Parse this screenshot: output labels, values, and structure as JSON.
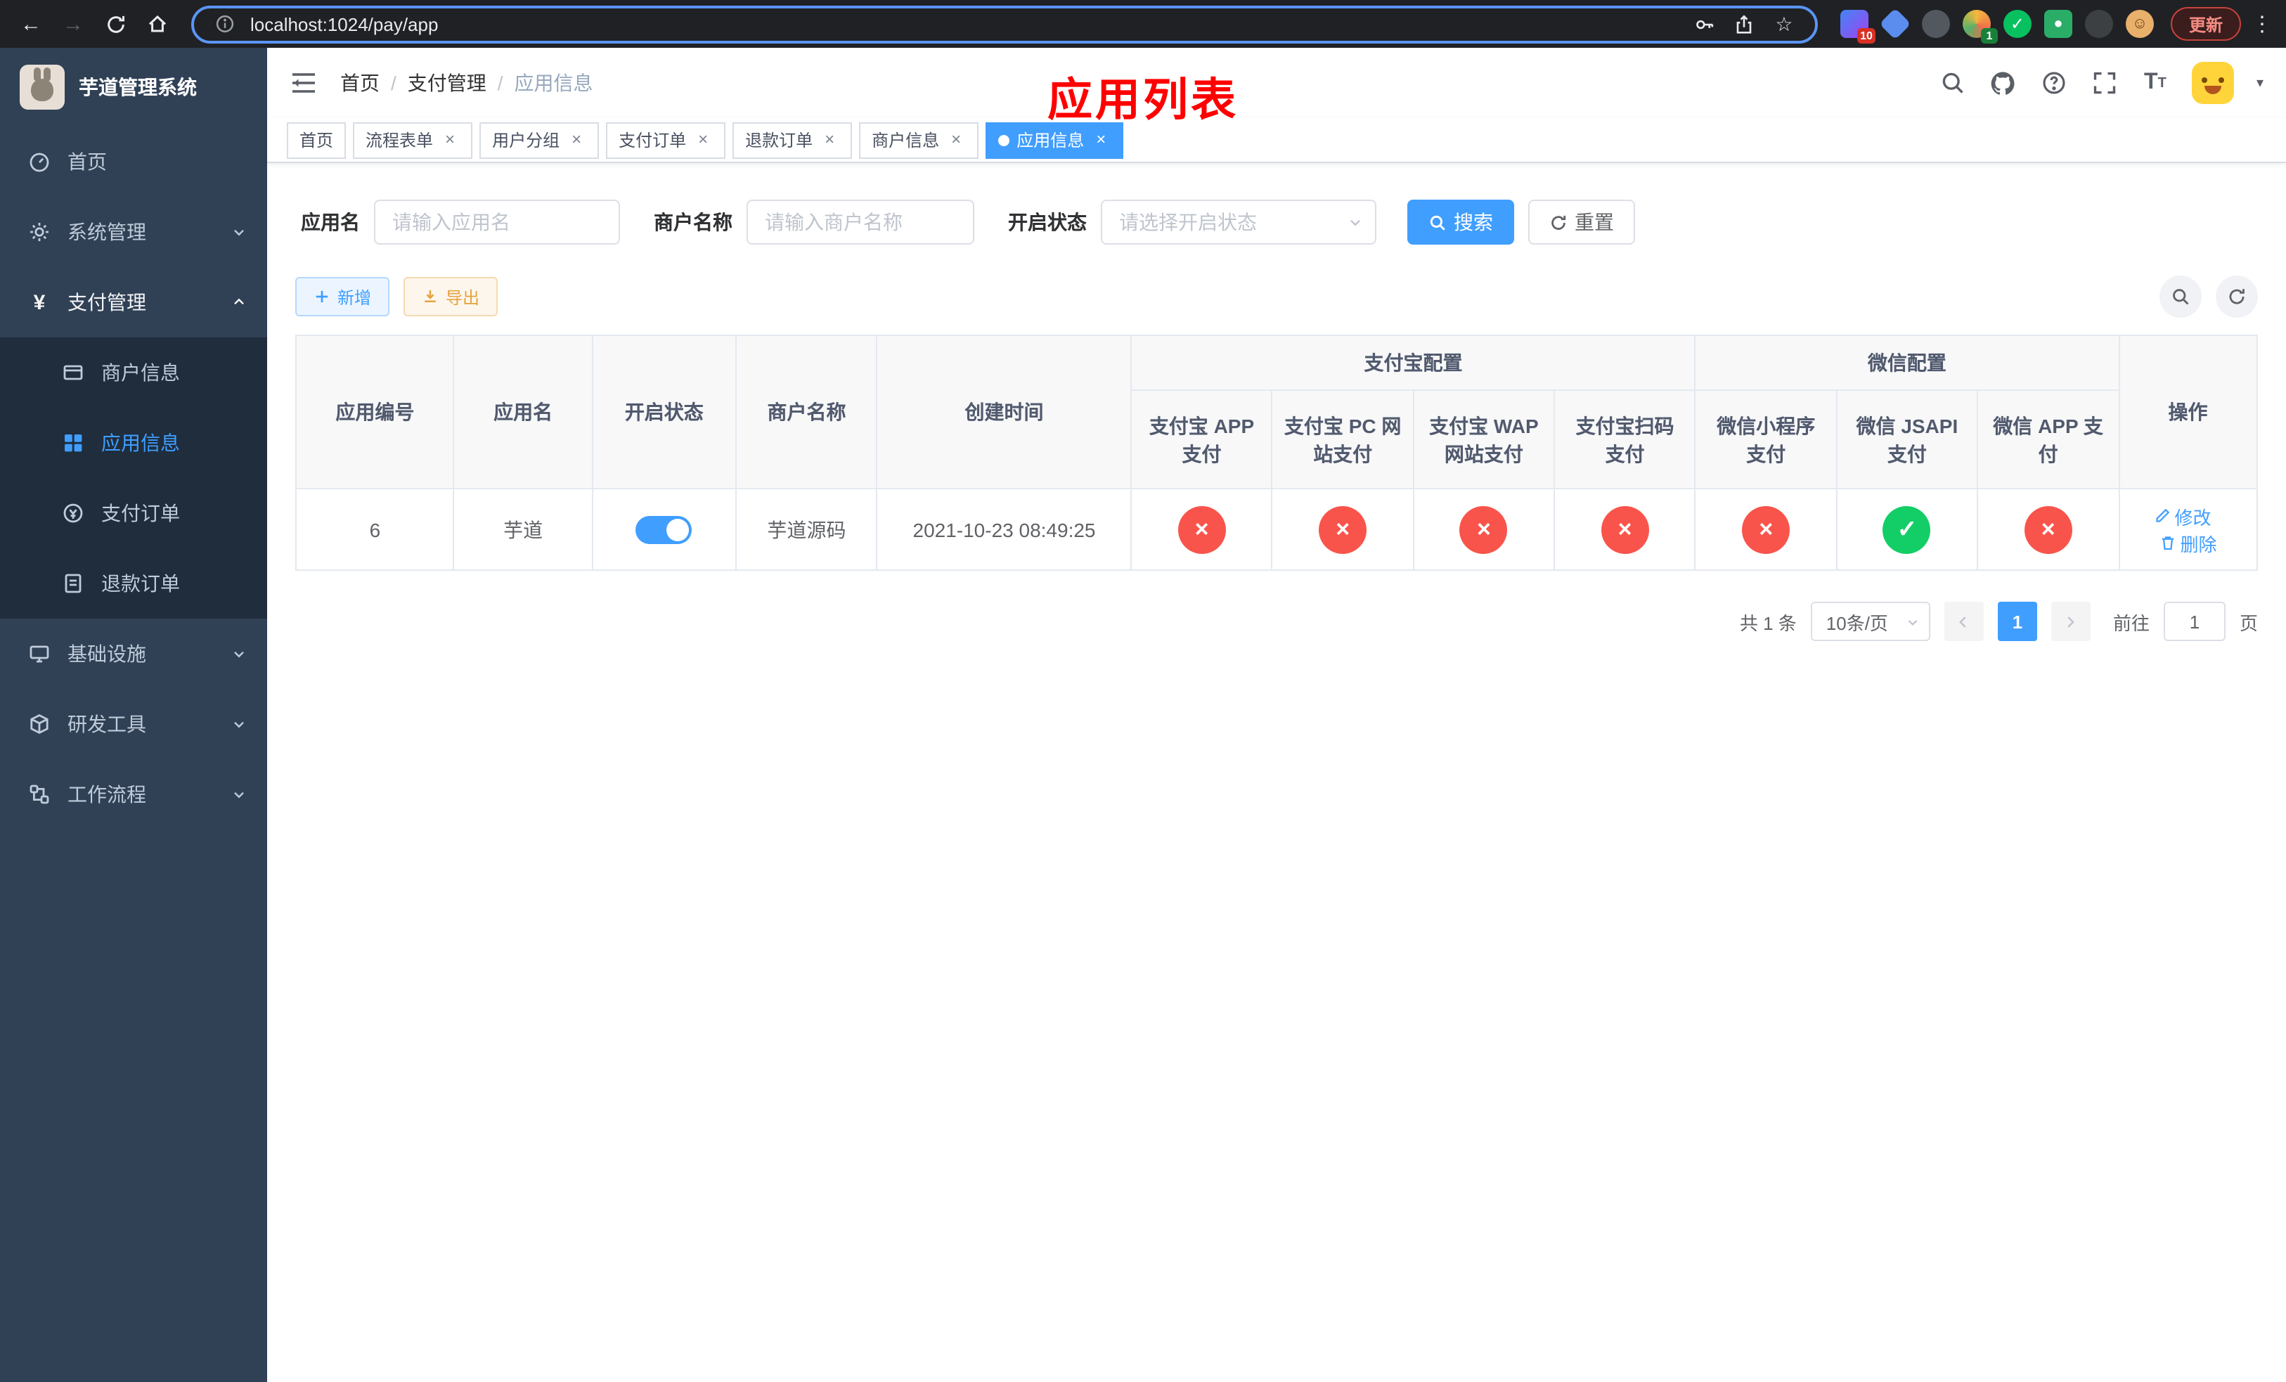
{
  "browser": {
    "url": "localhost:1024/pay/app",
    "update_label": "更新",
    "ext_badge_blocker": "10",
    "ext_badge_translator": "1"
  },
  "sidebar": {
    "app_title": "芋道管理系统",
    "items": [
      {
        "label": "首页"
      },
      {
        "label": "系统管理"
      },
      {
        "label": "支付管理"
      },
      {
        "label": "商户信息"
      },
      {
        "label": "应用信息"
      },
      {
        "label": "支付订单"
      },
      {
        "label": "退款订单"
      },
      {
        "label": "基础设施"
      },
      {
        "label": "研发工具"
      },
      {
        "label": "工作流程"
      }
    ]
  },
  "header": {
    "breadcrumb": {
      "home": "首页",
      "section": "支付管理",
      "current": "应用信息"
    },
    "watermark": "应用列表"
  },
  "tabs": [
    {
      "label": "首页"
    },
    {
      "label": "流程表单"
    },
    {
      "label": "用户分组"
    },
    {
      "label": "支付订单"
    },
    {
      "label": "退款订单"
    },
    {
      "label": "商户信息"
    },
    {
      "label": "应用信息"
    }
  ],
  "filters": {
    "app_name": {
      "label": "应用名",
      "placeholder": "请输入应用名"
    },
    "merchant": {
      "label": "商户名称",
      "placeholder": "请输入商户名称"
    },
    "status": {
      "label": "开启状态",
      "placeholder": "请选择开启状态"
    },
    "search": "搜索",
    "reset": "重置"
  },
  "toolbar": {
    "add": "新增",
    "export": "导出"
  },
  "table": {
    "headers": {
      "id": "应用编号",
      "name": "应用名",
      "status": "开启状态",
      "merchant": "商户名称",
      "created": "创建时间",
      "alipay_group": "支付宝配置",
      "wechat_group": "微信配置",
      "actions": "操作",
      "sub": [
        "支付宝 APP 支付",
        "支付宝 PC 网站支付",
        "支付宝 WAP 网站支付",
        "支付宝扫码支付",
        "微信小程序支付",
        "微信 JSAPI 支付",
        "微信 APP 支付"
      ]
    },
    "row": {
      "id": "6",
      "name": "芋道",
      "enabled": true,
      "merchant": "芋道源码",
      "created": "2021-10-23 08:49:25",
      "statuses": [
        "no",
        "no",
        "no",
        "no",
        "no",
        "yes",
        "no"
      ],
      "edit": "修改",
      "delete": "删除"
    }
  },
  "pagination": {
    "total": "共 1 条",
    "page_size": "10条/页",
    "page": "1",
    "goto_label": "前往",
    "goto_value": "1",
    "goto_unit": "页"
  },
  "colors": {
    "primary": "#409eff",
    "success": "#13ce66",
    "danger": "#f9544b",
    "watermark_red": "#ff0000",
    "sidebar_bg": "#304156",
    "submenu_bg": "#1f2d3d"
  }
}
